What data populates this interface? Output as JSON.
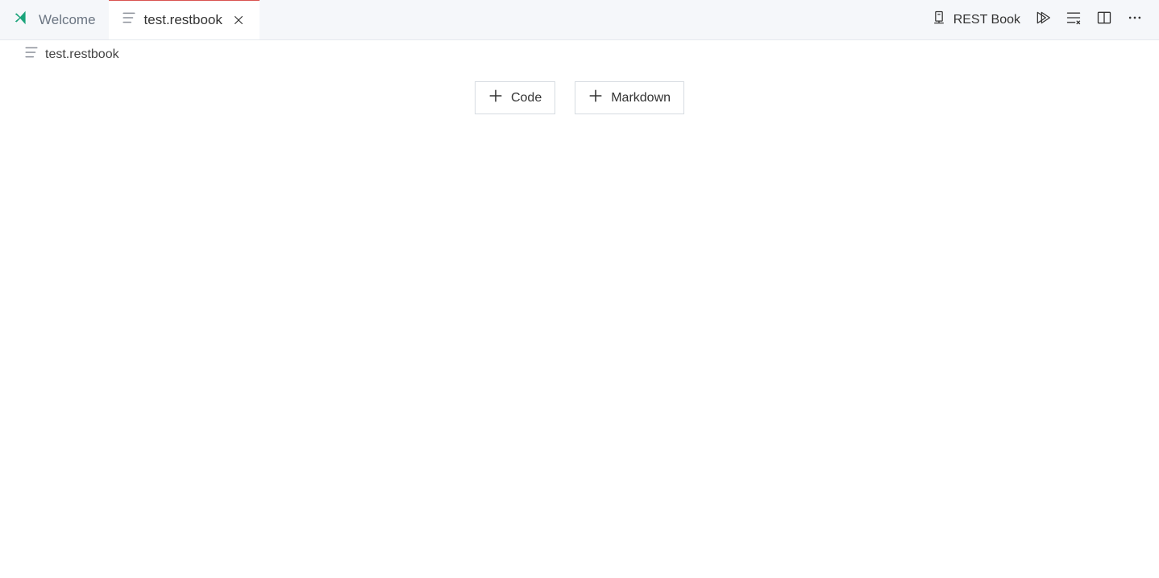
{
  "tabs": {
    "welcome": {
      "label": "Welcome"
    },
    "file": {
      "label": "test.restbook"
    }
  },
  "breadcrumb": {
    "filename": "test.restbook"
  },
  "kernel": {
    "label": "REST Book"
  },
  "buttons": {
    "code": "Code",
    "markdown": "Markdown"
  }
}
